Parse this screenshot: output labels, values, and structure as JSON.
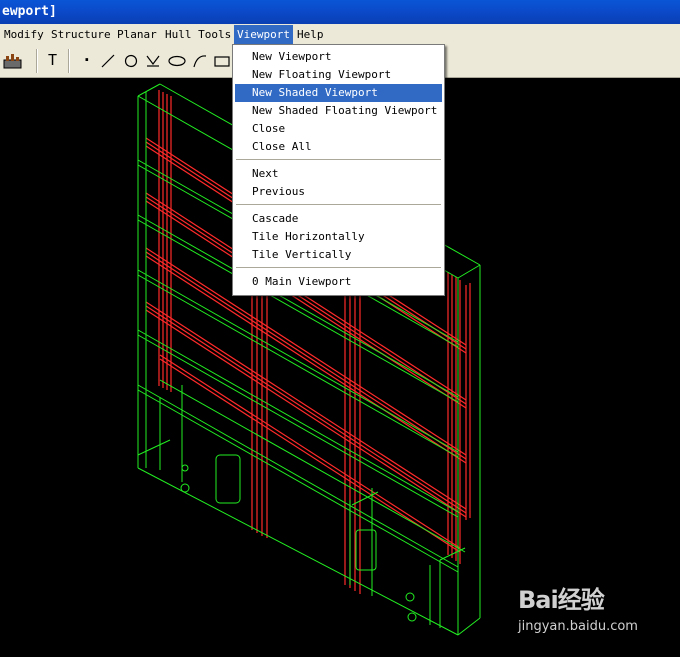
{
  "window": {
    "title": "ewport]"
  },
  "menubar": {
    "items": [
      "Modify",
      "Structure",
      "Planar",
      "Hull Tools",
      "Viewport",
      "Help"
    ],
    "active": "Viewport"
  },
  "viewport_menu": {
    "items": [
      "New Viewport",
      "New Floating Viewport",
      "New Shaded Viewport",
      "New Shaded Floating Viewport",
      "Close",
      "Close All",
      "Next",
      "Previous",
      "Cascade",
      "Tile Horizontally",
      "Tile Vertically",
      "0 Main Viewport"
    ],
    "highlighted": "New Shaded Viewport"
  },
  "toolbar": {
    "icons": [
      "structure-icon",
      "text-icon",
      "point-icon",
      "line-icon",
      "circle-icon",
      "angle-icon",
      "ellipse-icon",
      "arc-icon",
      "rectangle-icon"
    ],
    "glyphs": {
      "text": "T",
      "point": "·"
    }
  },
  "model": {
    "outline_color": "#00ff00",
    "stiffener_color": "#ff0000",
    "background": "#000000"
  },
  "watermark": {
    "logo": "Bai经验",
    "url": "jingyan.baidu.com"
  }
}
